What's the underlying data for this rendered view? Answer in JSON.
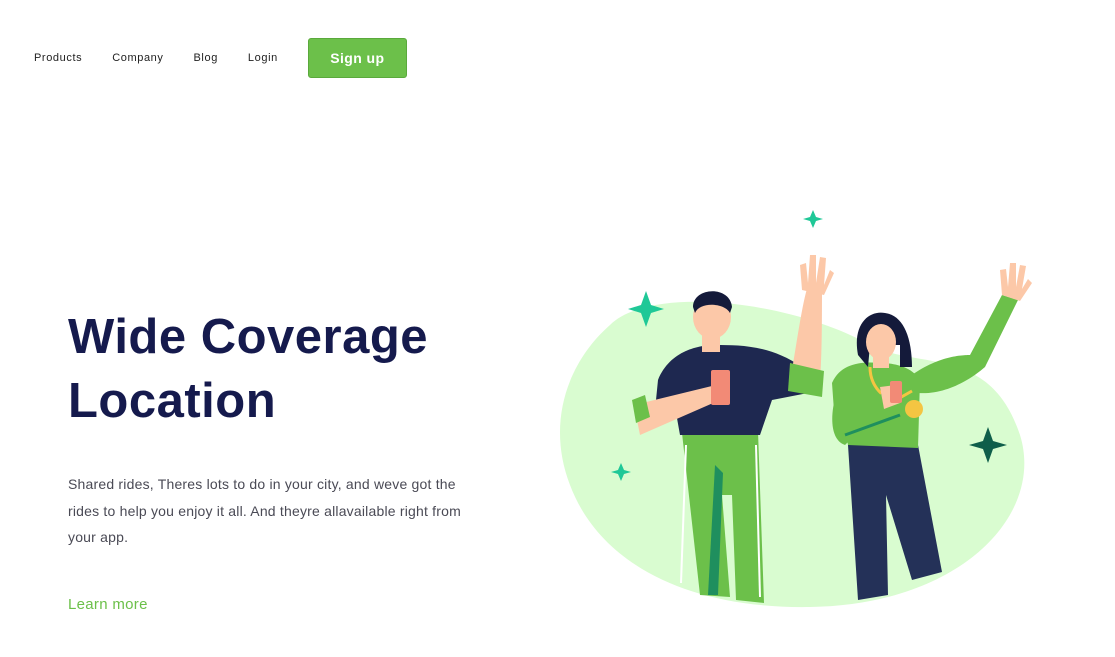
{
  "nav": {
    "items": [
      "Products",
      "Company",
      "Blog",
      "Login"
    ],
    "signup_label": "Sign up"
  },
  "hero": {
    "title_line1": "Wide Coverage",
    "title_line2": "Location",
    "description": "Shared rides, Theres lots to do in your city, and weve got the rides to help you enjoy it all. And theyre allavailable right from your app.",
    "cta_label": "Learn more"
  },
  "colors": {
    "accent": "#6cc04a",
    "title": "#151a4d",
    "blob": "#d9fcd0",
    "sparkle": "#1fc897",
    "sparkle_dark": "#0f5e4a",
    "navy": "#243158"
  },
  "illustration": {
    "icons": [
      "waving-man",
      "waving-woman",
      "sparkle-icon"
    ]
  }
}
